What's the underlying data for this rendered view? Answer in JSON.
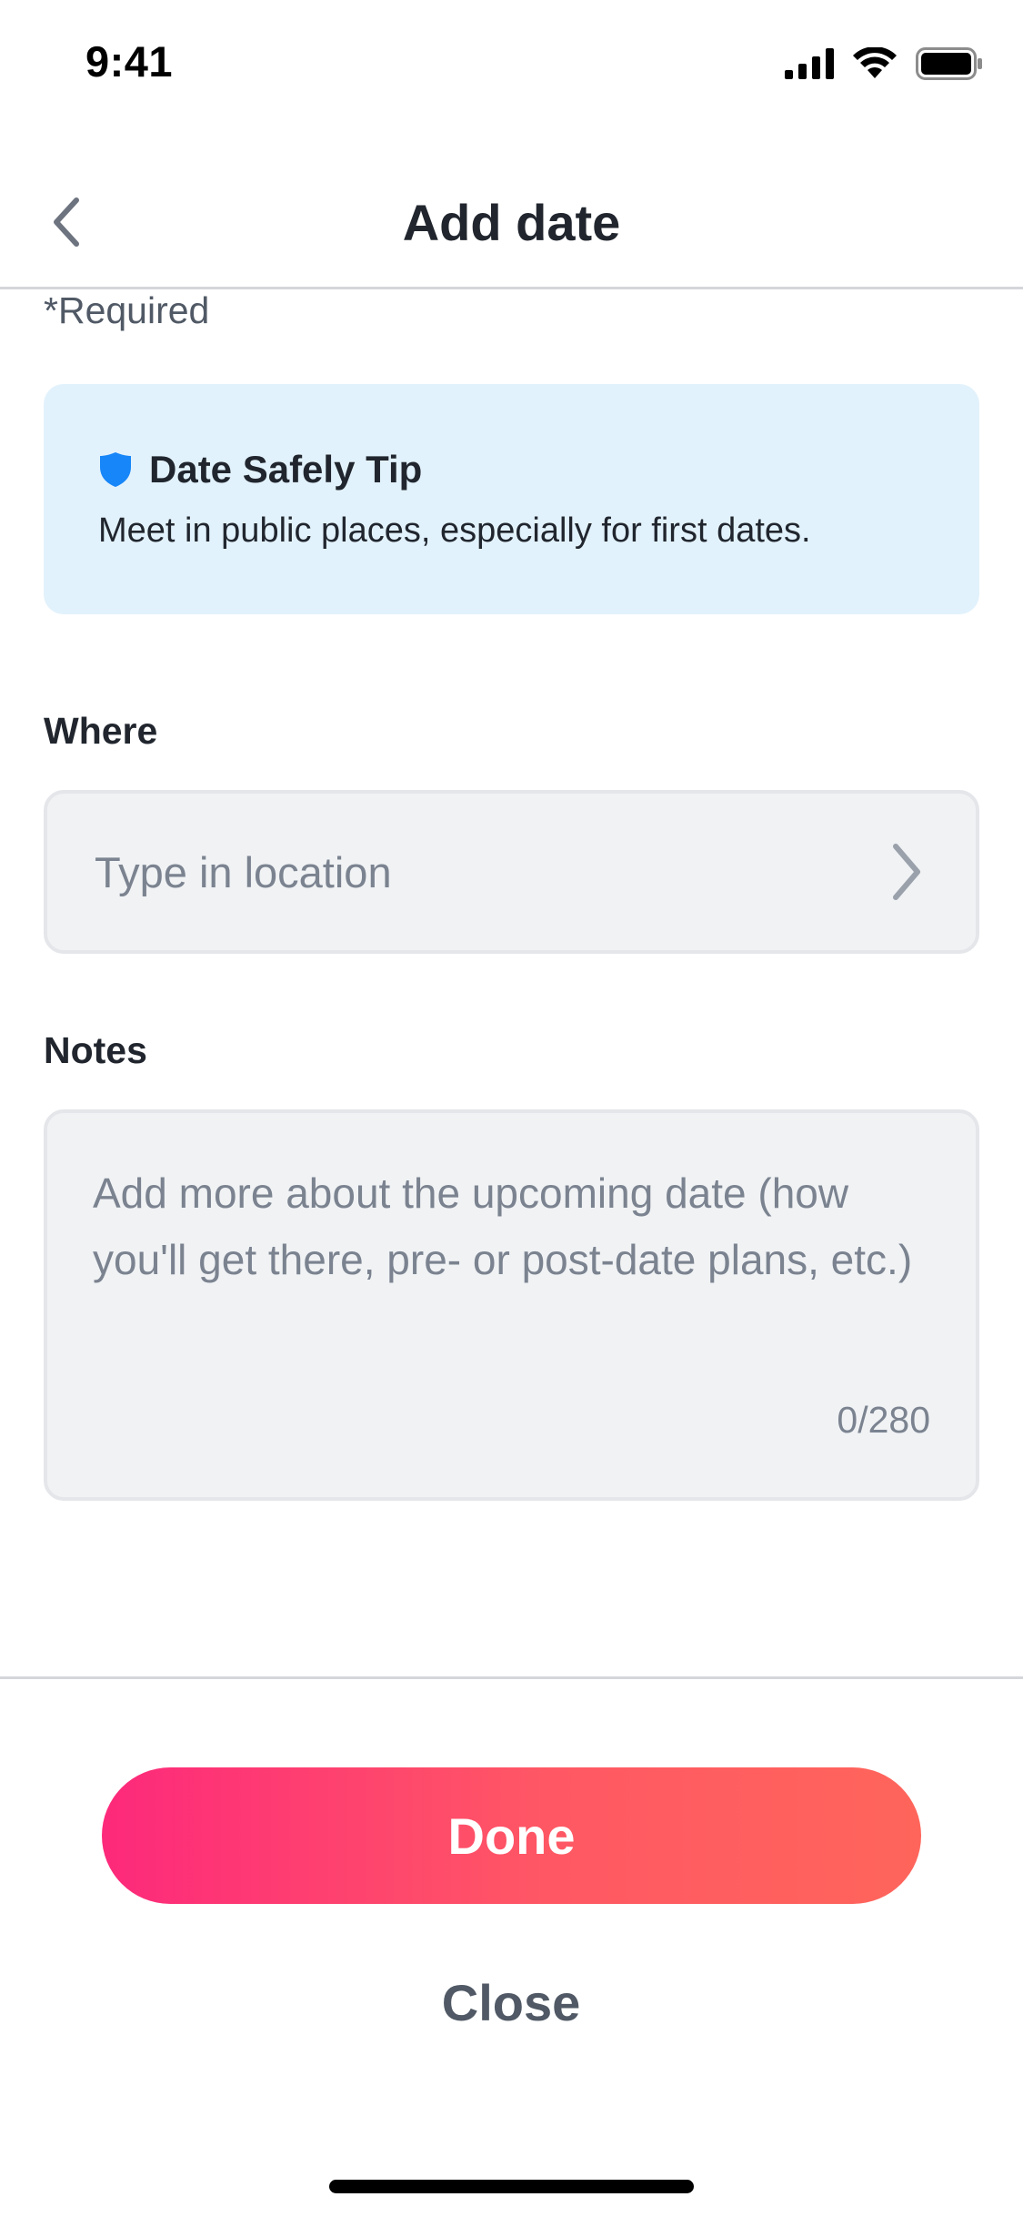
{
  "status_bar": {
    "time": "9:41",
    "icons": [
      "cellular-signal-icon",
      "wifi-icon",
      "battery-icon"
    ]
  },
  "header": {
    "title": "Add date",
    "back_icon": "chevron-left-icon"
  },
  "form": {
    "required_note": "*Required",
    "safety_tip": {
      "icon": "shield-icon",
      "title": "Date Safely Tip",
      "body": "Meet in public places, especially for first dates."
    },
    "where": {
      "label": "Where",
      "placeholder": "Type in location",
      "value": "",
      "icon": "chevron-right-icon"
    },
    "notes": {
      "label": "Notes",
      "placeholder": "Add more about the upcoming date (how you'll get there, pre- or post-date plans, etc.)",
      "value": "",
      "counter": "0/280"
    }
  },
  "footer": {
    "done_label": "Done",
    "close_label": "Close"
  },
  "colors": {
    "accent_gradient_start": "#fd297b",
    "accent_gradient_end": "#ff655b",
    "tip_background": "#e2f2fc",
    "shield_blue": "#1786f8",
    "field_background": "#f0f2f4"
  }
}
